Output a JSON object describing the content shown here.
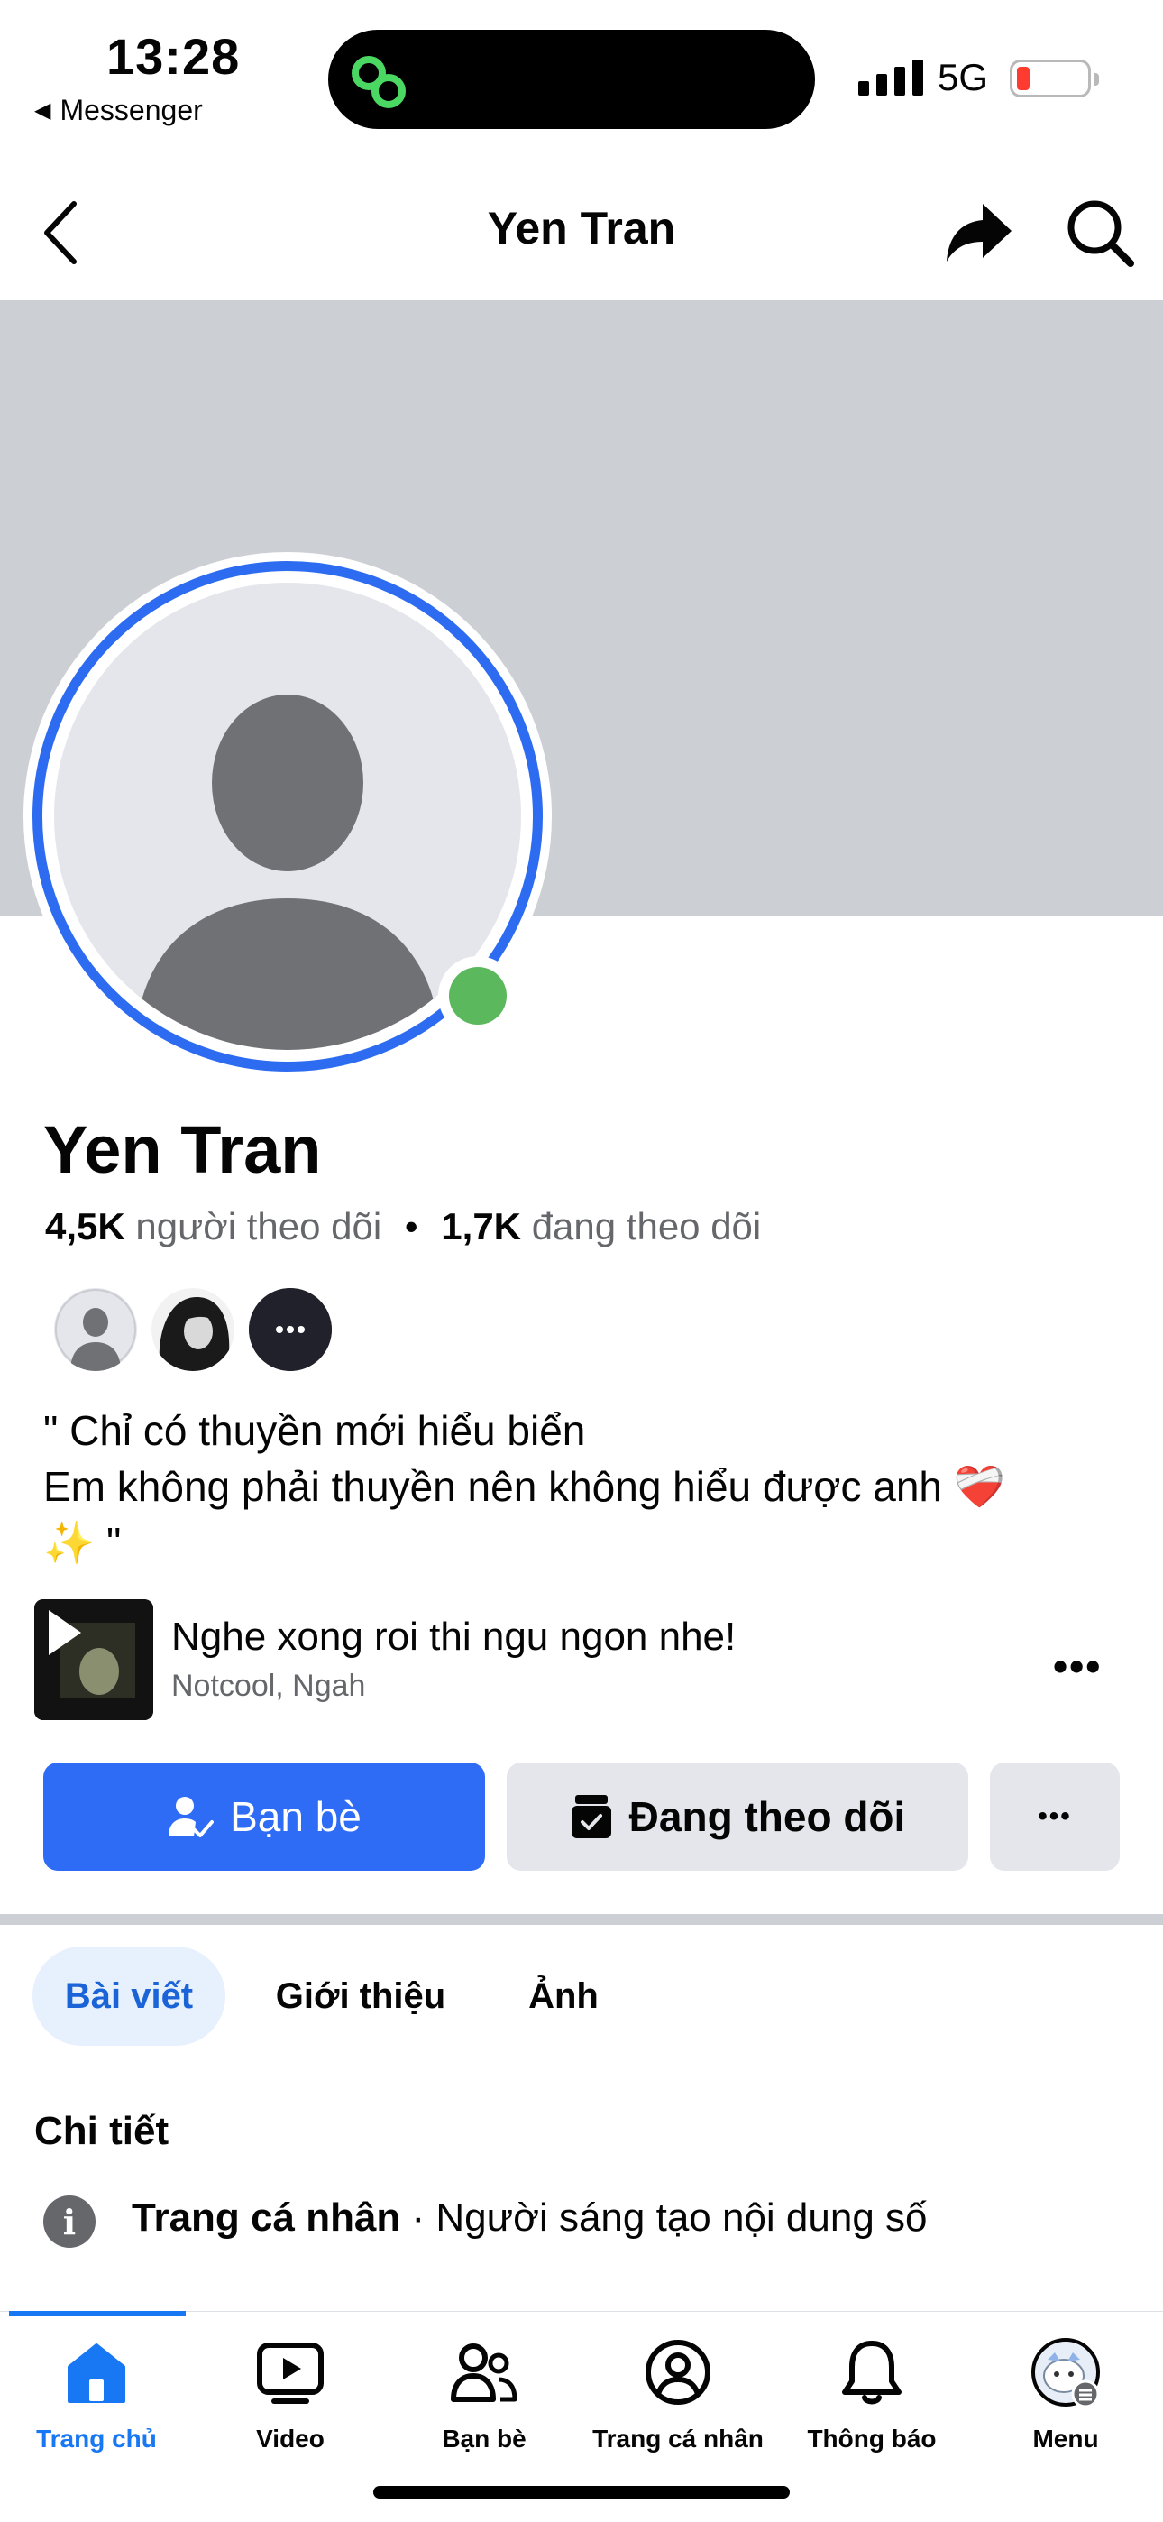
{
  "status_bar": {
    "time": "13:28",
    "back_app": "Messenger",
    "network": "5G"
  },
  "header": {
    "title": "Yen Tran"
  },
  "profile": {
    "name": "Yen Tran",
    "followers_count": "4,5K",
    "followers_label": "người theo dõi",
    "following_count": "1,7K",
    "following_label": "đang theo dõi",
    "bio_line1": "\" Chỉ có thuyền mới hiểu biển",
    "bio_line2": "Em không phải thuyền nên không hiểu được anh ❤️‍🩹",
    "bio_line3": "✨ \""
  },
  "music": {
    "title": "Nghe xong roi thi ngu ngon nhe!",
    "artist": "Notcool, Ngah",
    "more": "•••"
  },
  "actions": {
    "friends": "Bạn bè",
    "following": "Đang theo dõi",
    "more": "•••"
  },
  "tabs": {
    "posts": "Bài viết",
    "about": "Giới thiệu",
    "photos": "Ảnh"
  },
  "details": {
    "title": "Chi tiết",
    "info_bold": "Trang cá nhân",
    "info_rest": " · Người sáng tạo nội dung số"
  },
  "bottom_nav": {
    "home": "Trang chủ",
    "video": "Video",
    "friends": "Bạn bè",
    "profile": "Trang cá nhân",
    "notifications": "Thông báo",
    "menu": "Menu"
  },
  "colors": {
    "accent": "#1877f2",
    "primary_button": "#2f6cf5",
    "online": "#5cb85c",
    "avatar_ring": "#2d6cf0"
  }
}
